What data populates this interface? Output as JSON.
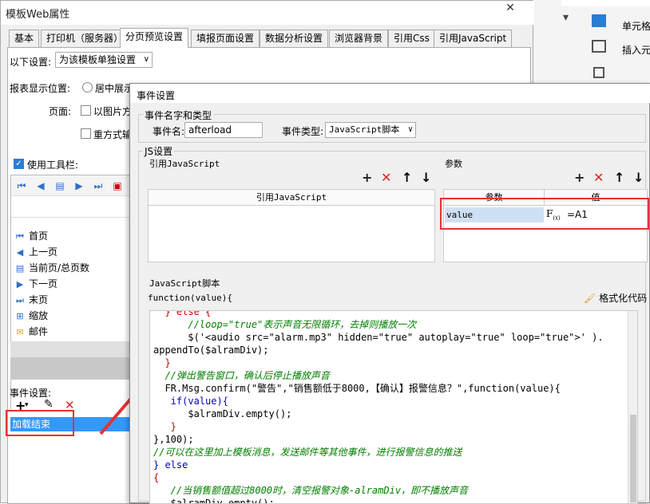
{
  "bg_app": {
    "labels": [
      "单元格",
      "插入元"
    ],
    "close_glyph": "✕"
  },
  "main": {
    "title": "模板Web属性",
    "close_glyph": "✕",
    "tabs": [
      {
        "label": "基本"
      },
      {
        "label": "打印机（服务器）"
      },
      {
        "label": "分页预览设置"
      },
      {
        "label": "填报页面设置"
      },
      {
        "label": "数据分析设置"
      },
      {
        "label": "浏览器背景"
      },
      {
        "label": "引用Css"
      },
      {
        "label": "引用JavaScript"
      }
    ],
    "settings_label": "以下设置:",
    "settings_value": "为该模板单独设置",
    "report_pos_label": "报表显示位置:",
    "report_pos_option": "居中展示",
    "page_label": "页面:",
    "page_option": "以图片方",
    "repeat_option": "重方式输",
    "toolbar_label": "使用工具栏:",
    "toolbar_items": [
      {
        "label": "首页",
        "icon": "first-page-icon"
      },
      {
        "label": "上一页",
        "icon": "prev-page-icon"
      },
      {
        "label": "当前页/总页数",
        "icon": "page-count-icon"
      },
      {
        "label": "下一页",
        "icon": "next-page-icon"
      },
      {
        "label": "末页",
        "icon": "last-page-icon"
      },
      {
        "label": "缩放",
        "icon": "zoom-icon"
      },
      {
        "label": "邮件",
        "icon": "mail-icon"
      }
    ],
    "event_label": "事件设置:",
    "event_item": "加载结束"
  },
  "event_dialog": {
    "title": "事件设置",
    "name_group": "事件名字和类型",
    "event_name_label": "事件名:",
    "event_name_value": "afterload",
    "event_type_label": "事件类型:",
    "event_type_value": "JavaScript脚本",
    "js_group": "JS设置",
    "ref_js_label": "引用JavaScript",
    "ref_js_header": "引用JavaScript",
    "params_label": "参数",
    "params_headers": [
      "参数",
      "值"
    ],
    "params_rows": [
      {
        "name": "value",
        "value": "=A1"
      }
    ],
    "script_label": "JavaScript脚本",
    "function_sig": "function(value){",
    "format_button": "格式化代码",
    "code_lines": [
      "  } else {",
      "      //loop=\"true\"表示声音无限循环，去掉则播放一次",
      "      $('<audio src=\"alarm.mp3\" hidden=\"true\" autoplay=\"true\" loop=\"true\">' ).",
      "appendTo($alramDiv);",
      "  }",
      "  //弹出警告窗口，确认后停止播放声音",
      "  FR.Msg.confirm(\"警告\",\"销售额低于8000,【确认】报警信息？\",function(value){",
      "   if(value){",
      "      $alramDiv.empty();",
      "   }",
      "},100);",
      "//可以在这里加上模板消息，发送邮件等其他事件，进行报警信息的推送",
      "} else",
      "{",
      "   //当销售额值超过8000时，清空报警对象-alramDiv，即不播放声音",
      "   $alramDiv.empty();"
    ]
  },
  "colors": {
    "selection": "#3399ff",
    "highlight_box": "#e63232",
    "keyword": "#0000cc",
    "comment": "#008000"
  }
}
